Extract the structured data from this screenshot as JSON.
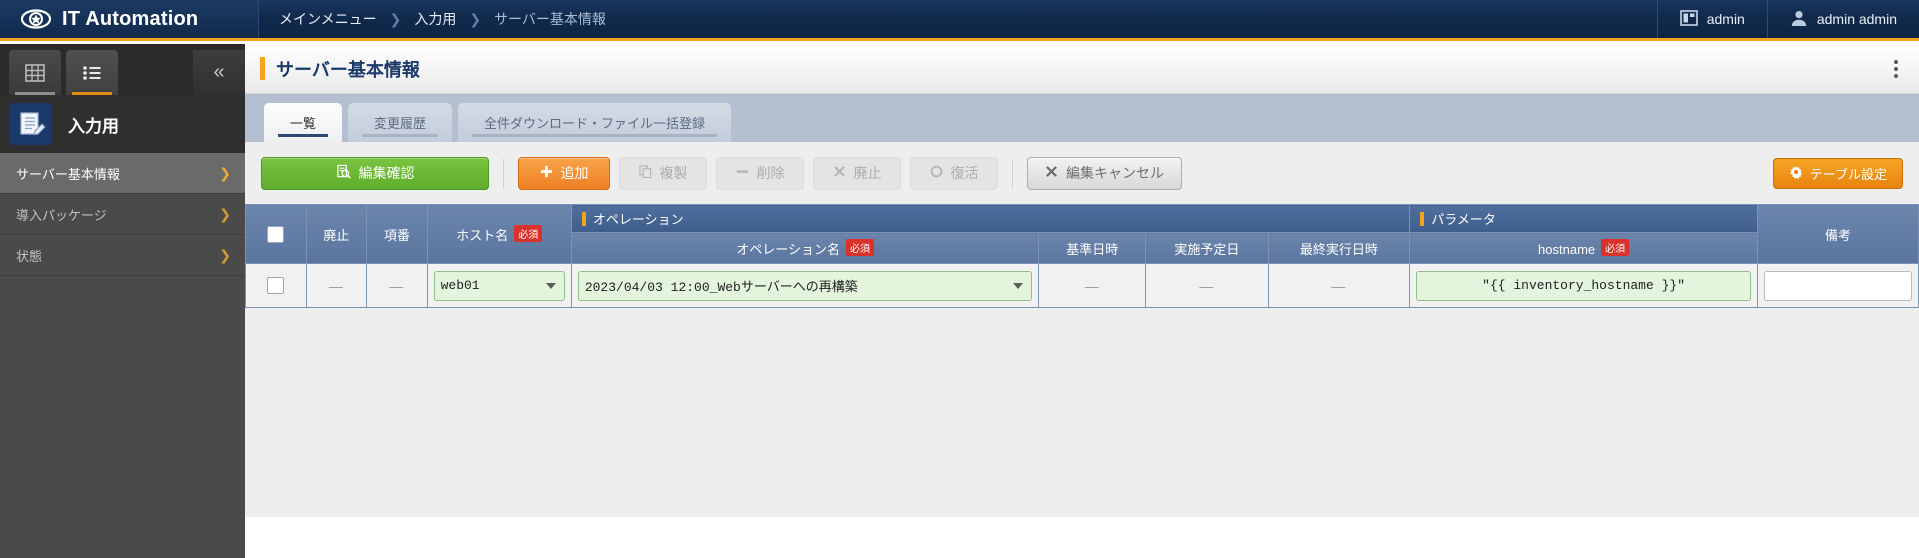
{
  "topbar": {
    "brand": "IT Automation",
    "logo_icon": "eye-swirl-logo-icon",
    "breadcrumb": [
      "メインメニュー",
      "入力用",
      "サーバー基本情報"
    ],
    "separator": "›",
    "workspace": {
      "icon": "workspace-panel-icon",
      "label": "admin"
    },
    "user": {
      "icon": "user-avatar-icon",
      "label": "admin admin"
    }
  },
  "sidebar": {
    "tabs": [
      {
        "name": "grid-view-tab",
        "icon": "grid-icon",
        "active": false
      },
      {
        "name": "list-view-tab",
        "icon": "list-icon",
        "active": true
      }
    ],
    "collapse_icon": "chevron-double-left-icon",
    "section": {
      "icon": "notepad-pencil-icon",
      "label": "入力用"
    },
    "items": [
      {
        "label": "サーバー基本情報",
        "active": true
      },
      {
        "label": "導入パッケージ",
        "active": false
      },
      {
        "label": "状態",
        "active": false
      }
    ],
    "chevron": "›"
  },
  "page": {
    "title": "サーバー基本情報",
    "menu_icon": "kebab-menu-icon",
    "tabs": [
      {
        "label": "一覧",
        "active": true
      },
      {
        "label": "変更履歴",
        "active": false
      },
      {
        "label": "全件ダウンロード・ファイル一括登録",
        "active": false
      }
    ]
  },
  "toolbar": {
    "confirm": {
      "label": "編集確認",
      "icon": "document-search-icon",
      "state": "enabled"
    },
    "add": {
      "label": "追加",
      "icon": "plus-icon",
      "state": "enabled"
    },
    "duplicate": {
      "label": "複製",
      "icon": "copy-icon",
      "state": "disabled"
    },
    "delete": {
      "label": "削除",
      "icon": "minus-icon",
      "state": "disabled"
    },
    "discontinue": {
      "label": "廃止",
      "icon": "cross-icon",
      "state": "disabled"
    },
    "restore": {
      "label": "復活",
      "icon": "circle-icon",
      "state": "disabled"
    },
    "cancel": {
      "label": "編集キャンセル",
      "icon": "cross-icon",
      "state": "enabled"
    },
    "table_settings": {
      "label": "テーブル設定",
      "icon": "gear-icon",
      "state": "enabled"
    }
  },
  "table": {
    "group_headers": {
      "operation": "オペレーション",
      "parameter": "パラメータ"
    },
    "columns": {
      "checkbox": "",
      "discontinue": "廃止",
      "row_no": "項番",
      "hostname": "ホスト名",
      "operation_name": "オペレーション名",
      "base_datetime": "基準日時",
      "scheduled_date": "実施予定日",
      "last_exec_datetime": "最終実行日時",
      "param_hostname": "hostname",
      "remarks": "備考"
    },
    "required_badge": "必須",
    "rows": [
      {
        "discontinue": "—",
        "row_no": "—",
        "hostname": "web01",
        "operation_name": "2023/04/03 12:00_Webサーバーへの再構築",
        "base_datetime": "—",
        "scheduled_date": "—",
        "last_exec_datetime": "—",
        "param_hostname": "\"{{   inventory_hostname   }}\"",
        "remarks": ""
      }
    ]
  },
  "colors": {
    "navy": "#10294b",
    "accent_orange": "#f5a21e",
    "green": "#6fba34",
    "orange": "#ef8023",
    "header_blue": "#5a759f",
    "required_red": "#d9322b",
    "input_green": "#e3f5dd"
  }
}
